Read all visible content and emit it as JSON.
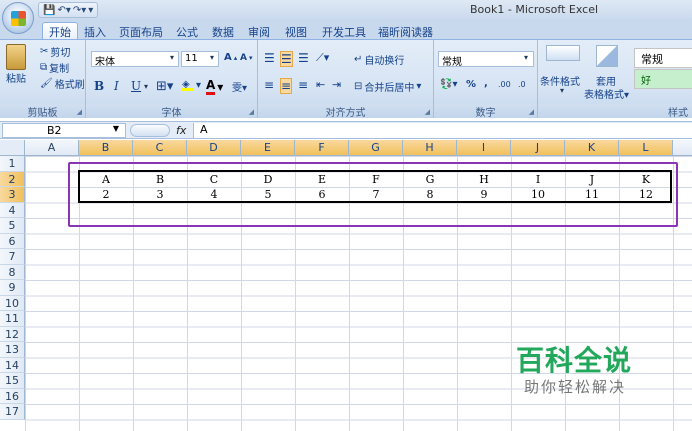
{
  "window": {
    "title": "Book1 - Microsoft Excel"
  },
  "tabs": [
    "开始",
    "插入",
    "页面布局",
    "公式",
    "数据",
    "审阅",
    "视图",
    "开发工具",
    "福昕阅读器"
  ],
  "ribbon": {
    "clipboard": {
      "label": "剪贴板",
      "paste": "粘贴",
      "cut": "剪切",
      "copy": "复制",
      "format_painter": "格式刷"
    },
    "font": {
      "label": "字体",
      "name": "宋体",
      "size": "11",
      "bold": "B",
      "italic": "I",
      "underline": "U",
      "grow": "A",
      "shrink": "A"
    },
    "alignment": {
      "label": "对齐方式",
      "wrap": "自动换行",
      "merge": "合并后居中"
    },
    "number": {
      "label": "数字",
      "format": "常规",
      "percent": "%",
      "comma": ",",
      "inc_dec": ".00",
      "dec_dec": ".0"
    },
    "styles": {
      "label": "样式",
      "conditional": "条件格式",
      "table_format": "套用\n表格格式",
      "normal": "常规",
      "good": "好"
    }
  },
  "formula_bar": {
    "name_box": "B2",
    "fx": "fx",
    "value": "A"
  },
  "columns": [
    "A",
    "B",
    "C",
    "D",
    "E",
    "F",
    "G",
    "H",
    "I",
    "J",
    "K",
    "L"
  ],
  "rows": [
    "1",
    "2",
    "3",
    "4",
    "5",
    "6",
    "7",
    "8",
    "9",
    "10",
    "11",
    "12",
    "13",
    "14",
    "15",
    "16",
    "17"
  ],
  "table": {
    "row2": [
      "A",
      "B",
      "C",
      "D",
      "E",
      "F",
      "G",
      "H",
      "I",
      "J",
      "K"
    ],
    "row3": [
      "2",
      "3",
      "4",
      "5",
      "6",
      "7",
      "8",
      "9",
      "10",
      "11",
      "12"
    ]
  },
  "watermark": {
    "brand": "百科全说",
    "tagline": "助你轻松解决"
  }
}
